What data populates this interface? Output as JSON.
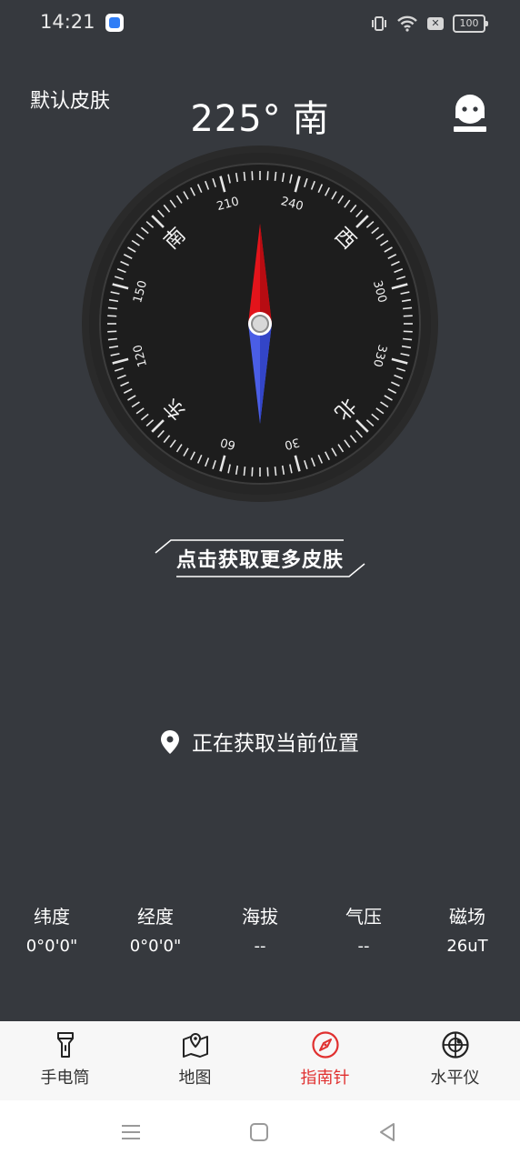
{
  "status_bar": {
    "time": "14:21",
    "battery": "100",
    "icons": [
      "app-notification-icon",
      "vibrate-icon",
      "wifi-icon",
      "sim-disabled-icon",
      "battery-icon"
    ]
  },
  "header": {
    "skin_label": "默认皮肤",
    "heading_degrees": "225°",
    "heading_direction": "南",
    "profile_icon": "profile-icon"
  },
  "compass": {
    "heading_value": 225,
    "cardinal": {
      "north": "北",
      "east": "东",
      "south": "南",
      "west": "西"
    },
    "tick_labels": [
      "30",
      "60",
      "120",
      "150",
      "210",
      "240",
      "300",
      "330"
    ],
    "needle_colors": {
      "north": "#e3141b",
      "south": "#4a5ee6"
    }
  },
  "more_skins": {
    "label": "点击获取更多皮肤"
  },
  "location": {
    "text": "正在获取当前位置",
    "icon": "location-pin-icon"
  },
  "stats": [
    {
      "label": "纬度",
      "value": "0°0'0\""
    },
    {
      "label": "经度",
      "value": "0°0'0\""
    },
    {
      "label": "海拔",
      "value": "--"
    },
    {
      "label": "气压",
      "value": "--"
    },
    {
      "label": "磁场",
      "value": "26uT"
    }
  ],
  "bottom_nav": {
    "items": [
      {
        "label": "手电筒",
        "icon": "flashlight-icon",
        "active": false
      },
      {
        "label": "地图",
        "icon": "map-icon",
        "active": false
      },
      {
        "label": "指南针",
        "icon": "compass-icon",
        "active": true
      },
      {
        "label": "水平仪",
        "icon": "level-icon",
        "active": false
      }
    ],
    "active_color": "#e0302f"
  },
  "system_nav": [
    "menu-icon",
    "home-icon",
    "back-icon"
  ]
}
